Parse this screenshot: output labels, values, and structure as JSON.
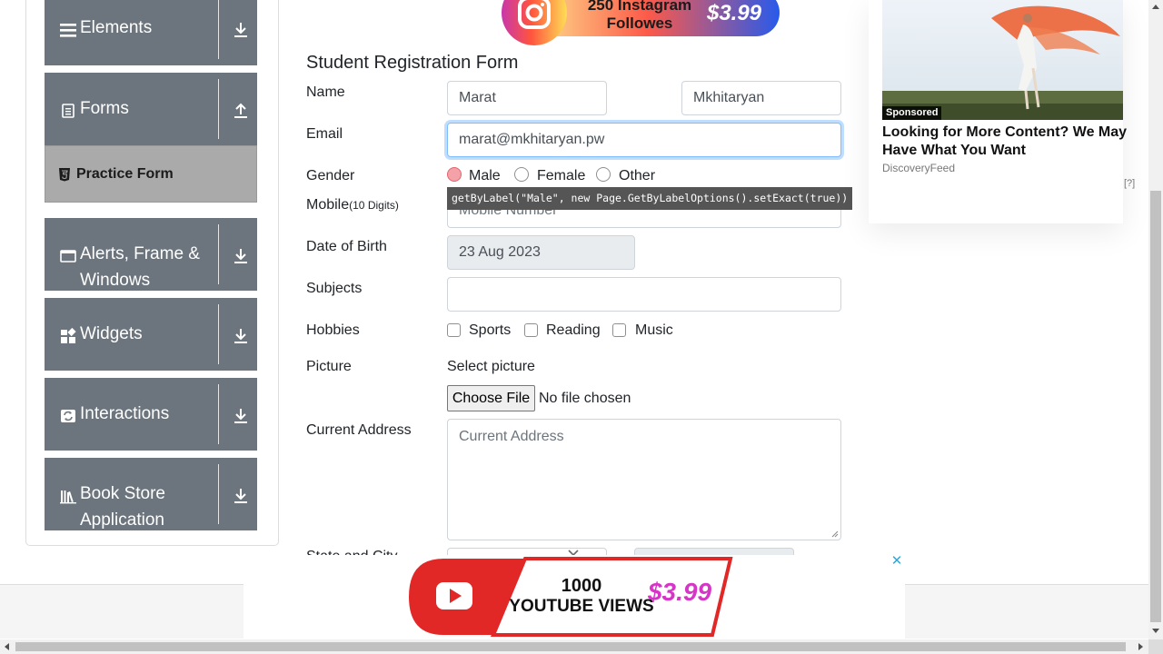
{
  "sidebar": {
    "groups": [
      {
        "label": "Elements",
        "icon": "hamburger-icon",
        "arrow": "download-arrow-icon"
      },
      {
        "label": "Forms",
        "icon": "document-icon",
        "arrow": "upload-arrow-icon"
      },
      {
        "label_line1": "Alerts, Frame &",
        "label_line2": "Windows",
        "icon": "window-icon",
        "arrow": "download-arrow-icon"
      },
      {
        "label": "Widgets",
        "icon": "widgets-icon",
        "arrow": "download-arrow-icon"
      },
      {
        "label": "Interactions",
        "icon": "interactions-icon",
        "arrow": "download-arrow-icon"
      },
      {
        "label_line1": "Book Store",
        "label_line2": "Application",
        "icon": "books-icon",
        "arrow": "download-arrow-icon"
      }
    ],
    "active_item": "Practice Form"
  },
  "form": {
    "title": "Student Registration Form",
    "labels": {
      "name": "Name",
      "email": "Email",
      "gender": "Gender",
      "mobile": "Mobile",
      "mobile_hint": "(10 Digits)",
      "dob": "Date of Birth",
      "subjects": "Subjects",
      "hobbies": "Hobbies",
      "picture": "Picture",
      "address": "Current Address",
      "state_city": "State and City"
    },
    "first_name": "Marat",
    "last_name": "Mkhitaryan",
    "email": "marat@mkhitaryan.pw",
    "gender_options": [
      "Male",
      "Female",
      "Other"
    ],
    "mobile_placeholder": "Mobile Number",
    "dob": "23 Aug 2023",
    "subjects": "",
    "hobbies": [
      "Sports",
      "Reading",
      "Music"
    ],
    "select_picture": "Select picture",
    "choose_file": "Choose File",
    "no_file": "No file chosen",
    "address_placeholder": "Current Address"
  },
  "tooltip": "getByLabel(\"Male\", new Page.GetByLabelOptions().setExact(true))",
  "ads": {
    "insta_line1": "250 Instagram",
    "insta_line2": "Followes",
    "insta_price": "$3.99",
    "side_badge": "Sponsored",
    "side_title": "Looking for More Content? We May Have What You Want",
    "side_source": "DiscoveryFeed",
    "side_q": "[?]",
    "yt_line1": "1000",
    "yt_line2": "YOUTUBE VIEWS",
    "yt_price": "$3.99",
    "close": "✕"
  },
  "colors": {
    "sidebar_bg": "#6c757d",
    "active_bg": "#aaaaaa",
    "focus_border": "#80bdff",
    "tooltip_bg": "#555555"
  }
}
